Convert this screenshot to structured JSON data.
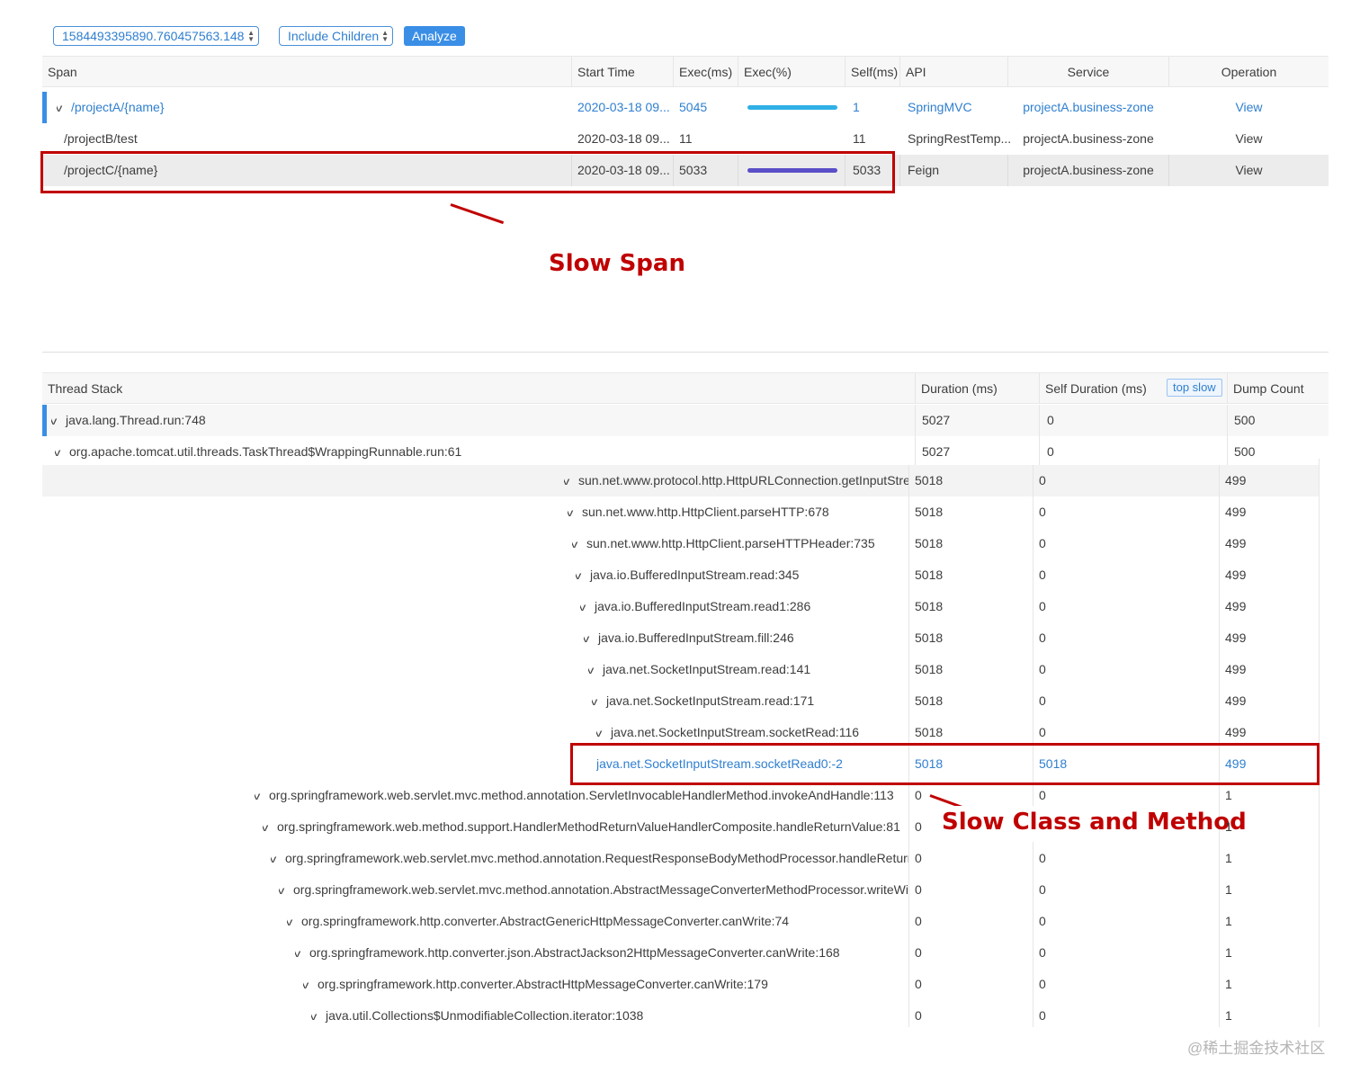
{
  "toolbar": {
    "snapshot_select": "1584493395890.760457563.148",
    "children_select": "Include Children",
    "analyze_button": "Analyze"
  },
  "span_table": {
    "headers": {
      "span": "Span",
      "start_time": "Start Time",
      "exec_ms": "Exec(ms)",
      "exec_pct": "Exec(%)",
      "self_ms": "Self(ms)",
      "api": "API",
      "service": "Service",
      "operation": "Operation"
    },
    "rows": [
      {
        "span": "/projectA/{name}",
        "start_time": "2020-03-18 09...",
        "exec_ms": "5045",
        "exec_pct": 1.0,
        "self_ms": "1",
        "api": "SpringMVC",
        "service": "projectA.business-zone",
        "operation": "View"
      },
      {
        "span": "/projectB/test",
        "start_time": "2020-03-18 09...",
        "exec_ms": "11",
        "exec_pct": 0,
        "self_ms": "11",
        "api": "SpringRestTemp...",
        "service": "projectA.business-zone",
        "operation": "View"
      },
      {
        "span": "/projectC/{name}",
        "start_time": "2020-03-18 09...",
        "exec_ms": "5033",
        "exec_pct": 1.0,
        "self_ms": "5033",
        "api": "Feign",
        "service": "projectA.business-zone",
        "operation": "View"
      }
    ],
    "bar_colors": [
      "#2fb0e6",
      "#5b4fc7"
    ]
  },
  "annotations": {
    "slow_span": "Slow Span",
    "slow_class_method": "Slow Class and Method"
  },
  "thread_table": {
    "headers": {
      "stack": "Thread Stack",
      "duration": "Duration (ms)",
      "self_duration": "Self Duration (ms)",
      "top_slow": "top slow",
      "dump_count": "Dump Count"
    },
    "rows": [
      {
        "method": "java.lang.Thread.run:748",
        "duration": "5027",
        "self": "0",
        "count": "500"
      },
      {
        "method": "org.apache.tomcat.util.threads.TaskThread$WrappingRunnable.run:61",
        "duration": "5027",
        "self": "0",
        "count": "500"
      },
      {
        "method": "sun.net.www.protocol.http.HttpURLConnection.getInputStream",
        "duration": "5018",
        "self": "0",
        "count": "499"
      },
      {
        "method": "sun.net.www.http.HttpClient.parseHTTP:678",
        "duration": "5018",
        "self": "0",
        "count": "499"
      },
      {
        "method": "sun.net.www.http.HttpClient.parseHTTPHeader:735",
        "duration": "5018",
        "self": "0",
        "count": "499"
      },
      {
        "method": "java.io.BufferedInputStream.read:345",
        "duration": "5018",
        "self": "0",
        "count": "499"
      },
      {
        "method": "java.io.BufferedInputStream.read1:286",
        "duration": "5018",
        "self": "0",
        "count": "499"
      },
      {
        "method": "java.io.BufferedInputStream.fill:246",
        "duration": "5018",
        "self": "0",
        "count": "499"
      },
      {
        "method": "java.net.SocketInputStream.read:141",
        "duration": "5018",
        "self": "0",
        "count": "499"
      },
      {
        "method": "java.net.SocketInputStream.read:171",
        "duration": "5018",
        "self": "0",
        "count": "499"
      },
      {
        "method": "java.net.SocketInputStream.socketRead:116",
        "duration": "5018",
        "self": "0",
        "count": "499"
      },
      {
        "method": "java.net.SocketInputStream.socketRead0:-2",
        "duration": "5018",
        "self": "5018",
        "count": "499"
      },
      {
        "method": "org.springframework.web.servlet.mvc.method.annotation.ServletInvocableHandlerMethod.invokeAndHandle:113",
        "duration": "0",
        "self": "0",
        "count": "1"
      },
      {
        "method": "org.springframework.web.method.support.HandlerMethodReturnValueHandlerComposite.handleReturnValue:81",
        "duration": "0",
        "self": "0",
        "count": "1"
      },
      {
        "method": "org.springframework.web.servlet.mvc.method.annotation.RequestResponseBodyMethodProcessor.handleReturnValue",
        "duration": "0",
        "self": "0",
        "count": "1"
      },
      {
        "method": "org.springframework.web.servlet.mvc.method.annotation.AbstractMessageConverterMethodProcessor.writeWithMessageConverters",
        "duration": "0",
        "self": "0",
        "count": "1"
      },
      {
        "method": "org.springframework.http.converter.AbstractGenericHttpMessageConverter.canWrite:74",
        "duration": "0",
        "self": "0",
        "count": "1"
      },
      {
        "method": "org.springframework.http.converter.json.AbstractJackson2HttpMessageConverter.canWrite:168",
        "duration": "0",
        "self": "0",
        "count": "1"
      },
      {
        "method": "org.springframework.http.converter.AbstractHttpMessageConverter.canWrite:179",
        "duration": "0",
        "self": "0",
        "count": "1"
      },
      {
        "method": "java.util.Collections$UnmodifiableCollection.iterator:1038",
        "duration": "0",
        "self": "0",
        "count": "1"
      }
    ]
  },
  "watermark": "@稀土掘金技术社区"
}
